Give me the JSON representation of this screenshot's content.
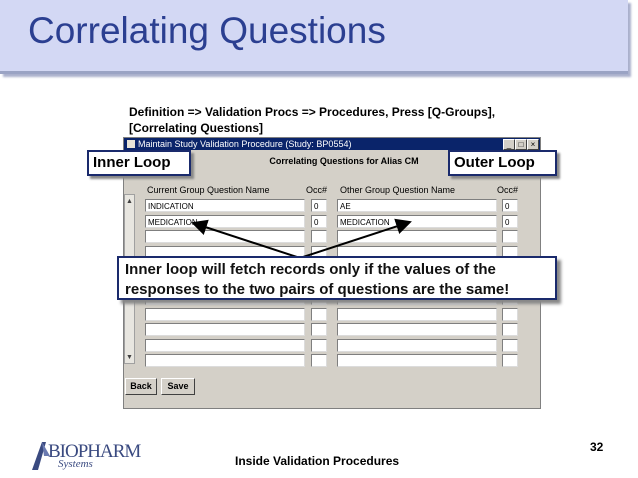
{
  "slide": {
    "title": "Correlating Questions",
    "path_line1": "Definition => Validation Procs => Procedures, Press [Q-Groups],",
    "path_line2": "[Correlating Questions]",
    "page_number": "32",
    "footer": "Inside Validation Procedures"
  },
  "window": {
    "title": "Maintain Study Validation Procedure (Study: BP0554)",
    "panel_title": "Correlating Questions for Alias CM",
    "columns": {
      "current": "Current Group Question Name",
      "occ1": "Occ#",
      "other": "Other Group Question Name",
      "occ2": "Occ#"
    },
    "rows": [
      {
        "current": "INDICATION",
        "occ1": "0",
        "other": "AE",
        "occ2": "0"
      },
      {
        "current": "MEDICATION",
        "occ1": "0",
        "other": "MEDICATION",
        "occ2": "0"
      },
      {
        "current": "",
        "occ1": "",
        "other": "",
        "occ2": ""
      },
      {
        "current": "",
        "occ1": "",
        "other": "",
        "occ2": ""
      },
      {
        "current": "",
        "occ1": "",
        "other": "",
        "occ2": ""
      },
      {
        "current": "",
        "occ1": "",
        "other": "",
        "occ2": ""
      },
      {
        "current": "",
        "occ1": "",
        "other": "",
        "occ2": ""
      },
      {
        "current": "",
        "occ1": "",
        "other": "",
        "occ2": ""
      },
      {
        "current": "",
        "occ1": "",
        "other": "",
        "occ2": ""
      },
      {
        "current": "",
        "occ1": "",
        "other": "",
        "occ2": ""
      },
      {
        "current": "",
        "occ1": "",
        "other": "",
        "occ2": ""
      }
    ],
    "buttons": {
      "back": "Back",
      "save": "Save"
    }
  },
  "callouts": {
    "inner": "Inner Loop",
    "outer": "Outer Loop",
    "line1": "Inner loop will fetch records only if the values of the",
    "line2": "responses to the two pairs of questions are the same!"
  },
  "logo": {
    "name": "BIOPHARM",
    "sub": "Systems"
  },
  "colors": {
    "title_band": "#d3d8f4",
    "title_text": "#2b3f91",
    "window_titlebar": "#0a246a",
    "callout_border": "#1a2a6c"
  }
}
